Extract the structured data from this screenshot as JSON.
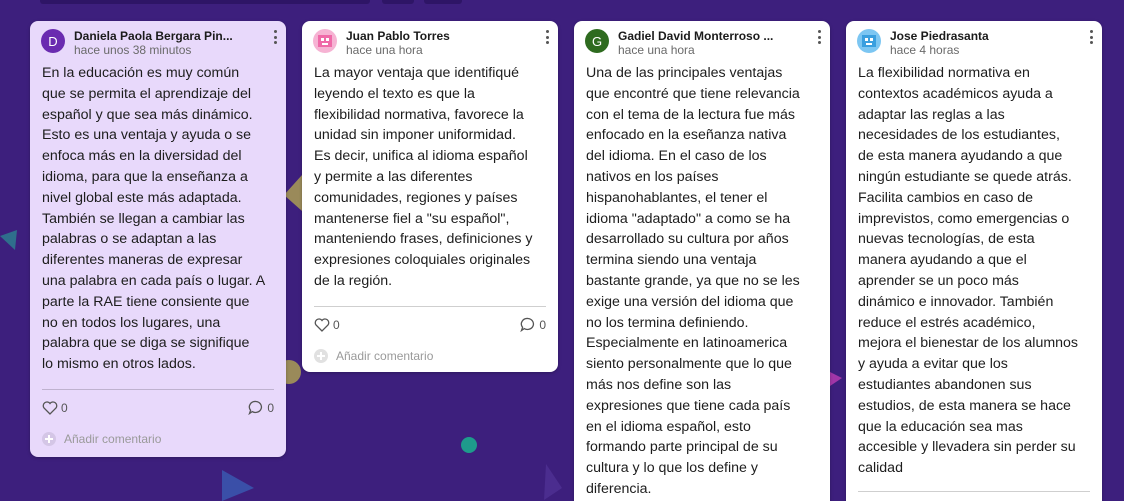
{
  "cards": [
    {
      "author": "Daniela Paola Bergara Pin...",
      "time": "hace unos 38 minutos",
      "avatar_letter": "D",
      "avatar_color": "#6a2bb0",
      "background": "#e8d9fb",
      "text": "En la educación es muy común\nque se permita el aprendizaje del\nespañol y que sea más dinámico.\nEsto es una ventaja y ayuda o se\nenfoca más en la diversidad del\nidioma, para que la enseñanza a\nnivel global este más adaptada.\nTambién se llegan a cambiar las\npalabras o se adaptan a las\ndiferentes maneras de expresar\nuna palabra en cada país o lugar. A\nparte la RAE tiene consiente que\nno en todos los lugares, una\npalabra que se diga se signifique\nlo mismo en otros lados.",
      "likes": "0",
      "comments": "0",
      "comment_placeholder": "Añadir comentario"
    },
    {
      "author": "Juan Pablo Torres",
      "time": "hace una hora",
      "avatar_letter": "",
      "avatar_color": "#f6b3d3",
      "background": "#ffffff",
      "text": "La mayor ventaja que identifiqué\nleyendo el texto es que la\nflexibilidad normativa, favorece la\nunidad sin imponer uniformidad.\nEs decir, unifica al idioma español\ny permite a las diferentes\ncomunidades, regiones y países\nmantenerse fiel a \"su español\",\nmanteniendo frases, definiciones y\nexpresiones coloquiales originales\nde la región.",
      "likes": "0",
      "comments": "0",
      "comment_placeholder": "Añadir comentario"
    },
    {
      "author": "Gadiel David Monterroso ...",
      "time": "hace una hora",
      "avatar_letter": "G",
      "avatar_color": "#2e6b1f",
      "background": "#ffffff",
      "text": "Una de las principales ventajas\nque encontré que tiene relevancia\ncon el tema de la lectura fue más\nenfocado en la eseñanza nativa\ndel idioma. En el caso de los\nnativos en los países\nhispanohablantes, el tener el\nidioma \"adaptado\" a como se ha\ndesarrollado su cultura por años\ntermina siendo una ventaja\nbastante grande, ya que no se les\nexige una versión del idioma que\nno los termina definiendo.\nEspecialmente en latinoamerica\nsiento personalmente que lo que\nmás nos define son las\nexpresiones que tiene cada país\nen el idioma español, esto\nformando parte principal de su\ncultura y lo que los define y\ndiferencia."
    },
    {
      "author": "Jose Piedrasanta",
      "time": "hace 4 horas",
      "avatar_letter": "",
      "avatar_color": "#7cc6f2",
      "background": "#ffffff",
      "text": "La flexibilidad normativa en\ncontextos académicos ayuda a\nadaptar las reglas a las\nnecesidades de los estudiantes,\nde esta manera ayudando a que\nningún estudiante se quede atrás.\nFacilita cambios en caso de\nimprevistos, como emergencias o\nnuevas tecnologías, de esta\nmanera ayudando a que el\naprender se un poco más\ndinámico e innovador. También\nreduce el estrés académico,\nmejora el bienestar de los alumnos\ny ayuda a evitar que los\nestudiantes abandonen sus\nestudios, de esta manera se hace\nque la educación sea mas\naccesible y llevadera sin perder su\ncalidad"
    }
  ],
  "icons": {
    "like": "heart-icon",
    "comment": "comment-bubble-icon",
    "menu": "more-vertical-icon",
    "add": "plus-icon"
  },
  "colors": {
    "board_background": "#3d1f7d"
  }
}
